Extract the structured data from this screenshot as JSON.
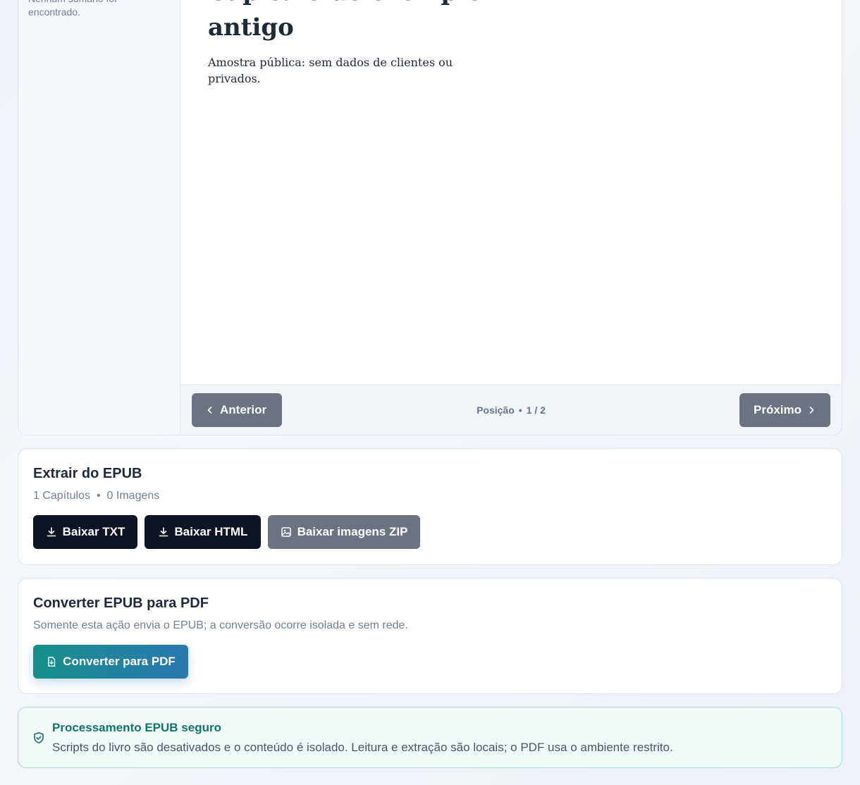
{
  "sidebar": {
    "empty_message": "Nenhum sumário foi encontrado."
  },
  "reader": {
    "chapter_title": "Capítulo de exemplo antigo",
    "chapter_body": "Amostra pública: sem dados de clientes ou privados.",
    "prev_label": "Anterior",
    "next_label": "Próximo",
    "position_label": "Posição",
    "position_value": "1 / 2"
  },
  "extract": {
    "title": "Extrair do EPUB",
    "chapters_count": "1 Capítulos",
    "images_count": "0 Imagens",
    "txt_label": "Baixar TXT",
    "html_label": "Baixar HTML",
    "zip_label": "Baixar imagens ZIP"
  },
  "convert": {
    "title": "Converter EPUB para PDF",
    "description": "Somente esta ação envia o EPUB; a conversão ocorre isolada e sem rede.",
    "button_label": "Converter para PDF"
  },
  "security": {
    "title": "Processamento EPUB seguro",
    "text": "Scripts do livro são desativados e o conteúdo é isolado. Leitura e extração são locais; o PDF usa o ambiente restrito."
  },
  "icons": {
    "prev": "chevron-left-icon",
    "next": "chevron-right-icon",
    "download": "download-icon",
    "image": "image-icon",
    "file_download": "file-download-icon",
    "shield": "shield-check-icon"
  },
  "colors": {
    "dark_button": "#0f1424",
    "gray_button": "#6b7280",
    "accent_teal": "#16908a",
    "accent_blue": "#2b78b2",
    "security_title": "#0f766e"
  }
}
